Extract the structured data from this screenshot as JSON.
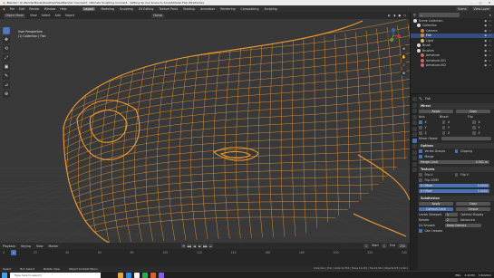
{
  "window": {
    "title": "Blender* [C:\\RenderMerak\\Desktop\\Files\\Blender Courses\\7. Ultimate Sculpting Course\\3 - Setting Up Our Scene to Sculpt\\Model Fish Wireframe]",
    "controls": [
      "–",
      "▢",
      "✕"
    ]
  },
  "menu": {
    "items": [
      "File",
      "Edit",
      "Render",
      "Window",
      "Help"
    ],
    "workspaces": [
      "Layout",
      "Modeling",
      "Sculpting",
      "UV Editing",
      "Texture Paint",
      "Shading",
      "Animation",
      "Rendering",
      "Compositing",
      "Scripting"
    ],
    "active_workspace": "Layout",
    "scene": "Scene",
    "view_layer": "View Layer"
  },
  "viewport_header": {
    "mode": "Object Mode",
    "menus": [
      "View",
      "Select",
      "Add",
      "Object"
    ],
    "transform": "Global",
    "shading_icons": [
      "◐",
      "◑",
      "●",
      "○"
    ]
  },
  "viewport": {
    "perspective": "User Perspective",
    "collection": "(1) Collection | Fish",
    "toolbar": [
      "⬚",
      "✥",
      "⟲",
      "⤢",
      "▣",
      "✎",
      "⊿",
      "⊕"
    ],
    "gizmo_axes": [
      "X",
      "Y",
      "Z"
    ],
    "nav": [
      "⊕",
      "✋",
      "🎥",
      "⊞"
    ],
    "wire_color": "#f39a2e",
    "bg_color": "#393939"
  },
  "timeline": {
    "menus": [
      "Playback",
      "Keying",
      "View",
      "Marker"
    ],
    "controls": [
      "⏮",
      "◀◀",
      "◀",
      "▶",
      "▶▶",
      "⏭"
    ],
    "start_label": "Start",
    "start": "1",
    "end_label": "End",
    "end": "250",
    "current_frame": "1",
    "ruler": [
      "0",
      "20",
      "40",
      "60",
      "80",
      "100",
      "120",
      "140",
      "160",
      "180",
      "200",
      "220",
      "240"
    ]
  },
  "status": {
    "items": [
      "Select",
      "Box Select",
      "Rotate View",
      "Object Context Menu"
    ],
    "right": "Collection | Fish | Verts:12,354 | Faces:12,152 | Tris:24,304 | Objects:0/3 | 2.90.1"
  },
  "taskbar": {
    "search_placeholder": "Type here to search",
    "apps": [
      "#e8a33d",
      "#2b8ee6",
      "#f2f2f2",
      "#2fa84f",
      "#e05c2b",
      "#8a5ce6"
    ],
    "time": "4:40 PM",
    "date": "7/20/2021",
    "lang": "ENG"
  },
  "outliner": {
    "title": "Scene Collection",
    "items": [
      {
        "label": "Scene Collection",
        "indent": 0,
        "color": "#dcdcdc",
        "selected": false
      },
      {
        "label": "Collection",
        "indent": 1,
        "color": "#dcdcdc",
        "selected": false
      },
      {
        "label": "Camera",
        "indent": 2,
        "color": "#c08a4a",
        "selected": false
      },
      {
        "label": "Fish",
        "indent": 2,
        "color": "#e8873a",
        "selected": true
      },
      {
        "label": "Light",
        "indent": 2,
        "color": "#c9c06a",
        "selected": false
      },
      {
        "label": "Brush",
        "indent": 1,
        "color": "#dcdcdc",
        "selected": false
      },
      {
        "label": "Brushes",
        "indent": 1,
        "color": "#dcdcdc",
        "selected": false
      },
      {
        "label": "Armature",
        "indent": 2,
        "color": "#c06c6c",
        "selected": false
      },
      {
        "label": "Armature.001",
        "indent": 2,
        "color": "#c06c6c",
        "selected": false
      },
      {
        "label": "Armature.002",
        "indent": 2,
        "color": "#c06c6c",
        "selected": false
      }
    ]
  },
  "properties": {
    "object_name": "Fish",
    "modifier": "Mirror",
    "apply": "Apply",
    "copy": "Copy",
    "axis_label": "Axis",
    "bisect_label": "Bisect",
    "flip_label": "Flip",
    "axes": [
      "X",
      "Y",
      "Z"
    ],
    "mirror_object_label": "Mirror Object",
    "options_label": "Options",
    "vertex_groups": "Vertex Groups",
    "clipping": "Clipping",
    "merge": "Merge",
    "merge_dist_label": "Merge Limit",
    "merge_dist": "0.001 m",
    "textures_label": "Textures",
    "flip_u": "Flip U",
    "flip_v": "Flip V",
    "flip_udim": "Flip UDIM",
    "u_offset": "U Offset",
    "v_offset": "V Offset",
    "u_offset_val": "0.0000",
    "v_offset_val": "0.0000",
    "sub_modifier": "Subdivision",
    "subdiv_types": [
      "Catmull-Clark",
      "Simple"
    ],
    "levels_viewport_label": "Levels Viewport",
    "levels_viewport": "1",
    "render_label": "Render",
    "render": "2",
    "optimal_display": "Optimal Display",
    "advanced_label": "Advanced",
    "uv_smooth_label": "UV Smooth",
    "uv_smooth": "Keep Corners",
    "use_creases": "Use Creases"
  }
}
